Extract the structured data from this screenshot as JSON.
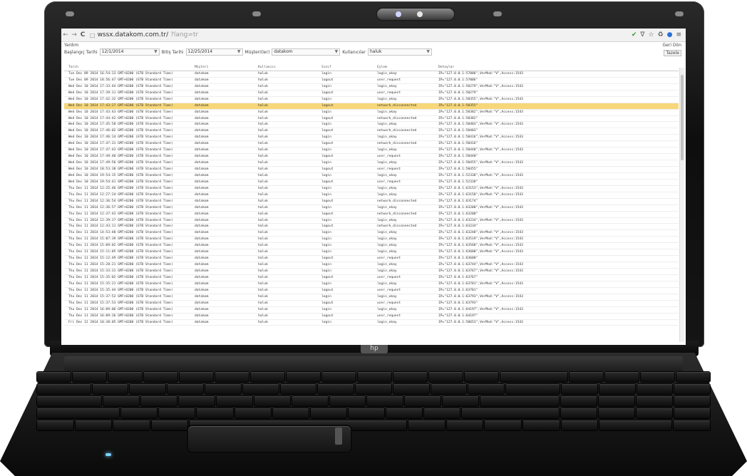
{
  "browser": {
    "url_host": "wssx.datakom.com.tr/",
    "url_path": "?lang=tr",
    "reload_glyph": "C"
  },
  "filters": {
    "help": "Yardım",
    "start_label": "Başlangıç Tarihi",
    "start_value": "12/1/2014",
    "end_label": "Bitiş Tarihi",
    "end_value": "12/25/2014",
    "customer_label": "Müşteri(ler)",
    "customer_value": "datakom",
    "user_label": "Kullanıcılar",
    "user_value": "haluk",
    "back_label": "Geri Dön",
    "refresh_label": "Tazele"
  },
  "table": {
    "columns": [
      "Tarih",
      "Müşteri",
      "Kullanıcı",
      "Sınıf",
      "Eylem",
      "Detaylar"
    ],
    "selected_index": 5,
    "rows": [
      [
        "Tue Dec 09 2014 16:54:13 GMT+0200 (GTB Standard Time)",
        "datakom",
        "haluk",
        "login",
        "login_okay",
        "IP=\"127.0.0.1:57006\",VerMod:\"V\",Access:1543"
      ],
      [
        "Tue Dec 09 2014 18:56:47 GMT+0200 (GTB Standard Time)",
        "datakom",
        "haluk",
        "logout",
        "user_request",
        "IP=\"127.0.0.1:57006\""
      ],
      [
        "Wed Dec 10 2014 17:33:44 GMT+0200 (GTB Standard Time)",
        "datakom",
        "haluk",
        "login",
        "login_okay",
        "IP=\"127.0.0.1:50279\",VerMod:\"V\",Access:1543"
      ],
      [
        "Wed Dec 10 2014 17:39:11 GMT+0200 (GTB Standard Time)",
        "datakom",
        "haluk",
        "logout",
        "user_request",
        "IP=\"127.0.0.1:50279\""
      ],
      [
        "Wed Dec 10 2014 17:42:32 GMT+0200 (GTB Standard Time)",
        "datakom",
        "haluk",
        "login",
        "login_okay",
        "IP=\"127.0.0.1:50355\",VerMod:\"V\",Access:1543"
      ],
      [
        "Wed Dec 10 2014 17:43:27 GMT+0200 (GTB Standard Time)",
        "datakom",
        "haluk",
        "logout",
        "network_disconnected",
        "IP=\"127.0.0.1:50355\""
      ],
      [
        "Wed Dec 10 2014 17:43:43 GMT+0200 (GTB Standard Time)",
        "datakom",
        "haluk",
        "login",
        "login_okay",
        "IP=\"127.0.0.1:50382\",VerMod:\"V\",Access:1543"
      ],
      [
        "Wed Dec 10 2014 17:44:42 GMT+0200 (GTB Standard Time)",
        "datakom",
        "haluk",
        "logout",
        "network_disconnected",
        "IP=\"127.0.0.1:50382\""
      ],
      [
        "Wed Dec 10 2014 17:45:58 GMT+0200 (GTB Standard Time)",
        "datakom",
        "haluk",
        "login",
        "login_okay",
        "IP=\"127.0.0.1:50403\",VerMod:\"V\",Access:1543"
      ],
      [
        "Wed Dec 10 2014 17:46:02 GMT+0200 (GTB Standard Time)",
        "datakom",
        "haluk",
        "logout",
        "network_disconnected",
        "IP=\"127.0.0.1:50403\""
      ],
      [
        "Wed Dec 10 2014 17:46:14 GMT+0200 (GTB Standard Time)",
        "datakom",
        "haluk",
        "login",
        "login_okay",
        "IP=\"127.0.0.1:50416\",VerMod:\"V\",Access:1543"
      ],
      [
        "Wed Dec 10 2014 17:47:31 GMT+0200 (GTB Standard Time)",
        "datakom",
        "haluk",
        "logout",
        "network_disconnected",
        "IP=\"127.0.0.1:50416\""
      ],
      [
        "Wed Dec 10 2014 17:47:43 GMT+0200 (GTB Standard Time)",
        "datakom",
        "haluk",
        "login",
        "login_okay",
        "IP=\"127.0.0.1:50440\",VerMod:\"V\",Access:1543"
      ],
      [
        "Wed Dec 10 2014 17:49:40 GMT+0200 (GTB Standard Time)",
        "datakom",
        "haluk",
        "logout",
        "user_request",
        "IP=\"127.0.0.1:50440\""
      ],
      [
        "Wed Dec 10 2014 17:49:56 GMT+0200 (GTB Standard Time)",
        "datakom",
        "haluk",
        "login",
        "login_okay",
        "IP=\"127.0.0.1:50455\",VerMod:\"V\",Access:1543"
      ],
      [
        "Wed Dec 10 2014 18:53:38 GMT+0200 (GTB Standard Time)",
        "datakom",
        "haluk",
        "logout",
        "user_request",
        "IP=\"127.0.0.1:50455\""
      ],
      [
        "Wed Dec 10 2014 19:54:15 GMT+0200 (GTB Standard Time)",
        "datakom",
        "haluk",
        "login",
        "login_okay",
        "IP=\"127.0.0.1:52338\",VerMod:\"V\",Access:1543"
      ],
      [
        "Wed Dec 10 2014 19:54:41 GMT+0200 (GTB Standard Time)",
        "datakom",
        "haluk",
        "logout",
        "user_request",
        "IP=\"127.0.0.1:52338\""
      ],
      [
        "Thu Dec 11 2014 12:25:46 GMT+0200 (GTB Standard Time)",
        "datakom",
        "haluk",
        "login",
        "login_okay",
        "IP=\"127.0.0.1:63153\",VerMod:\"V\",Access:1543"
      ],
      [
        "Thu Dec 11 2014 12:27:24 GMT+0200 (GTB Standard Time)",
        "datakom",
        "haluk",
        "login",
        "login_okay",
        "IP=\"127.0.0.1:63158\",VerMod:\"V\",Access:1543"
      ],
      [
        "Thu Dec 11 2014 12:36:54 GMT+0200 (GTB Standard Time)",
        "datakom",
        "haluk",
        "logout",
        "network_disconnected",
        "IP=\"127.0.0.1:63174\""
      ],
      [
        "Thu Dec 11 2014 12:36:57 GMT+0200 (GTB Standard Time)",
        "datakom",
        "haluk",
        "login",
        "login_okay",
        "IP=\"127.0.0.1:63200\",VerMod:\"V\",Access:1543"
      ],
      [
        "Thu Dec 11 2014 12:37:43 GMT+0200 (GTB Standard Time)",
        "datakom",
        "haluk",
        "logout",
        "network_disconnected",
        "IP=\"127.0.0.1:63200\""
      ],
      [
        "Thu Dec 11 2014 12:39:17 GMT+0200 (GTB Standard Time)",
        "datakom",
        "haluk",
        "login",
        "login_okay",
        "IP=\"127.0.0.1:63234\",VerMod:\"V\",Access:1543"
      ],
      [
        "Thu Dec 11 2014 12:43:11 GMT+0200 (GTB Standard Time)",
        "datakom",
        "haluk",
        "logout",
        "network_disconnected",
        "IP=\"127.0.0.1:63234\""
      ],
      [
        "Thu Dec 11 2014 14:53:48 GMT+0200 (GTB Standard Time)",
        "datakom",
        "haluk",
        "login",
        "login_okay",
        "IP=\"127.0.0.1:63248\",VerMod:\"V\",Access:1543"
      ],
      [
        "Thu Dec 11 2014 15:07:39 GMT+0200 (GTB Standard Time)",
        "datakom",
        "haluk",
        "login",
        "login_okay",
        "IP=\"127.0.0.1:63519\",VerMod:\"V\",Access:1543"
      ],
      [
        "Thu Dec 11 2014 15:09:02 GMT+0200 (GTB Standard Time)",
        "datakom",
        "haluk",
        "login",
        "login_okay",
        "IP=\"127.0.0.1:63568\",VerMod:\"V\",Access:1543"
      ],
      [
        "Thu Dec 11 2014 15:11:05 GMT+0200 (GTB Standard Time)",
        "datakom",
        "haluk",
        "login",
        "login_okay",
        "IP=\"127.0.0.1:63600\",VerMod:\"V\",Access:1543"
      ],
      [
        "Thu Dec 11 2014 15:12:49 GMT+0200 (GTB Standard Time)",
        "datakom",
        "haluk",
        "logout",
        "user_request",
        "IP=\"127.0.0.1:63600\""
      ],
      [
        "Thu Dec 11 2014 15:28:21 GMT+0200 (GTB Standard Time)",
        "datakom",
        "haluk",
        "login",
        "login_okay",
        "IP=\"127.0.0.1:63744\",VerMod:\"V\",Access:1543"
      ],
      [
        "Thu Dec 11 2014 15:33:31 GMT+0200 (GTB Standard Time)",
        "datakom",
        "haluk",
        "login",
        "login_okay",
        "IP=\"127.0.0.1:63767\",VerMod:\"V\",Access:1543"
      ],
      [
        "Thu Dec 11 2014 15:35:02 GMT+0200 (GTB Standard Time)",
        "datakom",
        "haluk",
        "logout",
        "user_request",
        "IP=\"127.0.0.1:63767\""
      ],
      [
        "Thu Dec 11 2014 15:35:21 GMT+0200 (GTB Standard Time)",
        "datakom",
        "haluk",
        "login",
        "login_okay",
        "IP=\"127.0.0.1:63781\",VerMod:\"V\",Access:1543"
      ],
      [
        "Thu Dec 11 2014 15:35:44 GMT+0200 (GTB Standard Time)",
        "datakom",
        "haluk",
        "logout",
        "user_request",
        "IP=\"127.0.0.1:63781\""
      ],
      [
        "Thu Dec 11 2014 15:37:52 GMT+0200 (GTB Standard Time)",
        "datakom",
        "haluk",
        "login",
        "login_okay",
        "IP=\"127.0.0.1:63793\",VerMod:\"V\",Access:1543"
      ],
      [
        "Thu Dec 11 2014 15:37:53 GMT+0200 (GTB Standard Time)",
        "datakom",
        "haluk",
        "logout",
        "user_request",
        "IP=\"127.0.0.1:63793\""
      ],
      [
        "Thu Dec 11 2014 16:09:06 GMT+0200 (GTB Standard Time)",
        "datakom",
        "haluk",
        "login",
        "login_okay",
        "IP=\"127.0.0.1:64197\",VerMod:\"V\",Access:1543"
      ],
      [
        "Thu Dec 11 2014 16:09:26 GMT+0200 (GTB Standard Time)",
        "datakom",
        "haluk",
        "logout",
        "user_request",
        "IP=\"127.0.0.1:64197\""
      ],
      [
        "Fri Dec 12 2014 10:38:05 GMT+0200 (GTB Standard Time)",
        "datakom",
        "haluk",
        "login",
        "login_okay",
        "IP=\"127.0.0.1:50653\",VerMod:\"V\",Access:1543"
      ]
    ]
  },
  "colors": {
    "selected_row": "#f7d77a",
    "laptop_body": "#141414"
  }
}
